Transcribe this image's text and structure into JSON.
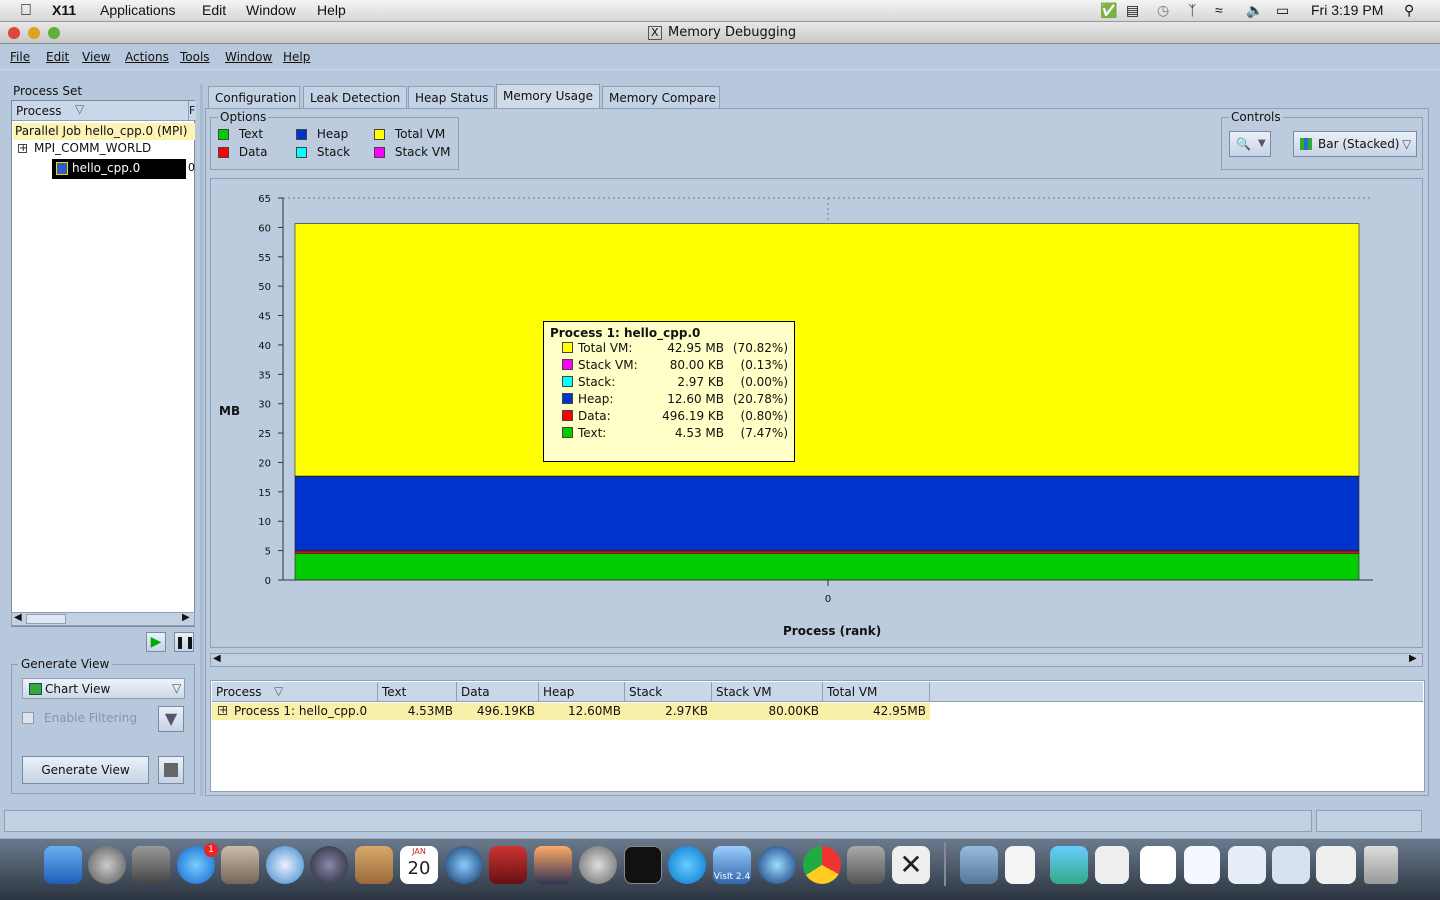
{
  "mac_menu": {
    "x11": "X11",
    "items": [
      "Applications",
      "Edit",
      "Window",
      "Help"
    ],
    "clock": "Fri 3:19 PM"
  },
  "window": {
    "title": "Memory Debugging"
  },
  "app_menu": [
    "File",
    "Edit",
    "View",
    "Actions",
    "Tools",
    "Window",
    "Help"
  ],
  "process_set": {
    "title": "Process Set",
    "col_process": "Process",
    "col_f": "F",
    "job": "Parallel Job hello_cpp.0 (MPI)",
    "comm": "MPI_COMM_WORLD",
    "proc": "hello_cpp.0",
    "proc_extra": "0"
  },
  "generate_view": {
    "title": "Generate View",
    "view_select": "Chart View",
    "filter": "Enable Filtering",
    "button": "Generate View"
  },
  "tabs": [
    "Configuration",
    "Leak Detection",
    "Heap Status",
    "Memory Usage",
    "Memory Compare"
  ],
  "options": {
    "title": "Options",
    "items": [
      {
        "label": "Text",
        "color": "#00cc00"
      },
      {
        "label": "Heap",
        "color": "#0033cc"
      },
      {
        "label": "Total VM",
        "color": "#ffff00"
      },
      {
        "label": "Data",
        "color": "#ff0000"
      },
      {
        "label": "Stack",
        "color": "#00ffff"
      },
      {
        "label": "Stack VM",
        "color": "#ff00ff"
      }
    ]
  },
  "controls": {
    "title": "Controls",
    "chart_type": "Bar (Stacked)"
  },
  "chart_data": {
    "type": "bar",
    "stacked": true,
    "categories": [
      "0"
    ],
    "xlabel": "Process (rank)",
    "ylabel": "MB",
    "ylim": [
      0,
      65
    ],
    "yticks": [
      0,
      5,
      10,
      15,
      20,
      25,
      30,
      35,
      40,
      45,
      50,
      55,
      60,
      65
    ],
    "series": [
      {
        "name": "Text",
        "color": "#00cc00",
        "values": [
          4.53
        ]
      },
      {
        "name": "Data",
        "color": "#ff0000",
        "values": [
          0.48
        ]
      },
      {
        "name": "Stack",
        "color": "#00ffff",
        "values": [
          0.003
        ]
      },
      {
        "name": "Heap",
        "color": "#0033cc",
        "values": [
          12.6
        ]
      },
      {
        "name": "Stack VM",
        "color": "#ff00ff",
        "values": [
          0.08
        ]
      },
      {
        "name": "Total VM",
        "color": "#ffff00",
        "values": [
          42.95
        ]
      }
    ]
  },
  "tooltip": {
    "title": "Process 1: hello_cpp.0",
    "rows": [
      {
        "label": "Total VM:",
        "value": "42.95 MB",
        "pct": "(70.82%)",
        "color": "#ffff00"
      },
      {
        "label": "Stack VM:",
        "value": "80.00 KB",
        "pct": "(0.13%)",
        "color": "#ff00ff"
      },
      {
        "label": "Stack:",
        "value": "2.97 KB",
        "pct": "(0.00%)",
        "color": "#00ffff"
      },
      {
        "label": "Heap:",
        "value": "12.60 MB",
        "pct": "(20.78%)",
        "color": "#0033cc"
      },
      {
        "label": "Data:",
        "value": "496.19 KB",
        "pct": "(0.80%)",
        "color": "#ff0000"
      },
      {
        "label": "Text:",
        "value": "4.53 MB",
        "pct": "(7.47%)",
        "color": "#00cc00"
      }
    ]
  },
  "table": {
    "headers": [
      "Process",
      "Text",
      "Data",
      "Heap",
      "Stack",
      "Stack VM",
      "Total VM"
    ],
    "row": [
      "Process 1: hello_cpp.0",
      "4.53MB",
      "496.19KB",
      "12.60MB",
      "2.97KB",
      "80.00KB",
      "42.95MB"
    ]
  },
  "dock": {
    "calendar_month": "JAN",
    "calendar_day": "20",
    "badge": "1",
    "visit": "VisIt 2.4"
  }
}
